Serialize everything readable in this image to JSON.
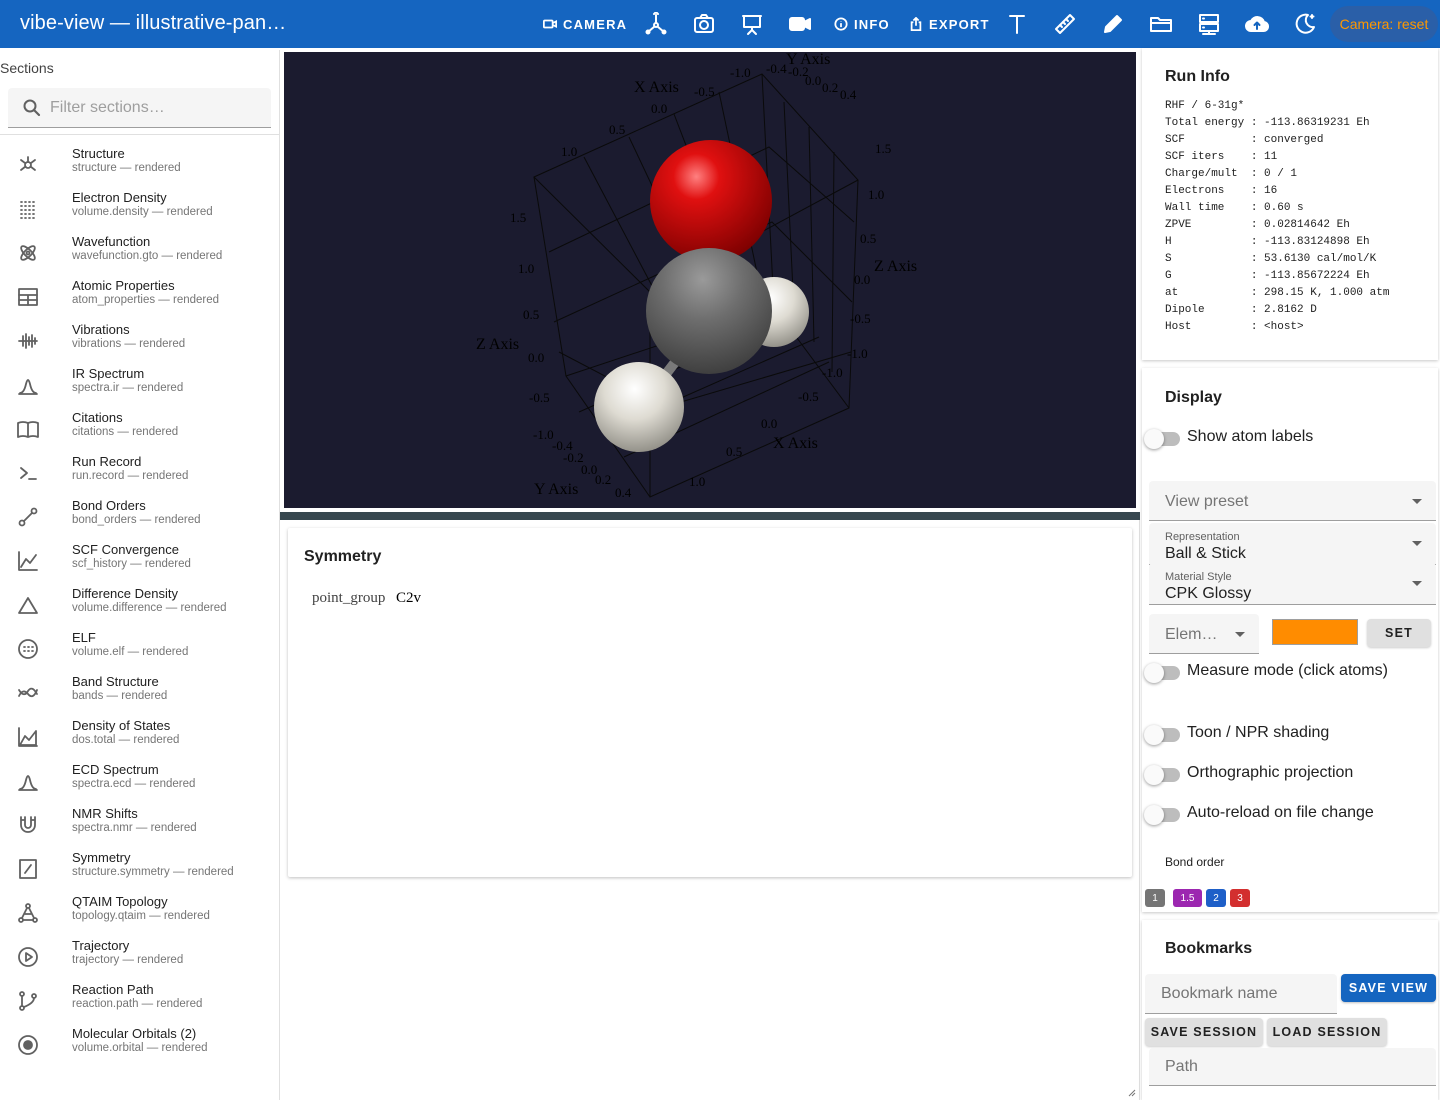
{
  "app": {
    "title": "vibe-view — illustrative-pan…"
  },
  "toolbar": {
    "camera_label": "CAMERA",
    "info_label": "INFO",
    "export_label": "EXPORT",
    "camera_reset_label": "Camera: reset",
    "icons": [
      "axes-icon",
      "screenshot-icon",
      "presentation-icon",
      "video-icon",
      "text-icon",
      "ruler-icon",
      "pencil-icon",
      "folder-icon",
      "server-icon",
      "cloud-upload-icon",
      "theme-icon"
    ]
  },
  "sidebar": {
    "heading": "Sections",
    "filter_placeholder": "Filter sections…",
    "items": [
      {
        "name": "Structure",
        "sub": "structure — rendered",
        "icon": "molecule-icon"
      },
      {
        "name": "Electron Density",
        "sub": "volume.density — rendered",
        "icon": "dot-grid-icon"
      },
      {
        "name": "Wavefunction",
        "sub": "wavefunction.gto — rendered",
        "icon": "atom-icon"
      },
      {
        "name": "Atomic Properties",
        "sub": "atom_properties — rendered",
        "icon": "table-icon"
      },
      {
        "name": "Vibrations",
        "sub": "vibrations — rendered",
        "icon": "waveform-icon"
      },
      {
        "name": "IR Spectrum",
        "sub": "spectra.ir — rendered",
        "icon": "peak-icon"
      },
      {
        "name": "Citations",
        "sub": "citations — rendered",
        "icon": "book-icon"
      },
      {
        "name": "Run Record",
        "sub": "run.record — rendered",
        "icon": "terminal-icon"
      },
      {
        "name": "Bond Orders",
        "sub": "bond_orders — rendered",
        "icon": "bond-icon"
      },
      {
        "name": "SCF Convergence",
        "sub": "scf_history — rendered",
        "icon": "line-chart-icon"
      },
      {
        "name": "Difference Density",
        "sub": "volume.difference — rendered",
        "icon": "triangle-icon"
      },
      {
        "name": "ELF",
        "sub": "volume.elf — rendered",
        "icon": "dotted-circle-icon"
      },
      {
        "name": "Band Structure",
        "sub": "bands — rendered",
        "icon": "bands-icon"
      },
      {
        "name": "Density of States",
        "sub": "dos.total — rendered",
        "icon": "area-chart-icon"
      },
      {
        "name": "ECD Spectrum",
        "sub": "spectra.ecd — rendered",
        "icon": "peak-icon"
      },
      {
        "name": "NMR Shifts",
        "sub": "spectra.nmr — rendered",
        "icon": "magnet-icon"
      },
      {
        "name": "Symmetry",
        "sub": "structure.symmetry — rendered",
        "icon": "mirror-icon"
      },
      {
        "name": "QTAIM Topology",
        "sub": "topology.qtaim — rendered",
        "icon": "graph-icon"
      },
      {
        "name": "Trajectory",
        "sub": "trajectory — rendered",
        "icon": "play-icon"
      },
      {
        "name": "Reaction Path",
        "sub": "reaction.path — rendered",
        "icon": "branch-icon"
      },
      {
        "name": "Molecular Orbitals (2)",
        "sub": "volume.orbital — rendered",
        "icon": "orbital-icon"
      }
    ]
  },
  "viewer": {
    "axis_labels": {
      "x": "X Axis",
      "y": "Y Axis",
      "z": "Z Axis"
    },
    "ticks": {
      "top_x": [
        "0.5",
        "0.0",
        "-0.5",
        "-1.0"
      ],
      "top_y": [
        "-0.4",
        "-0.2",
        "0.0",
        "0.2",
        "0.4"
      ],
      "right_z": [
        "1.5",
        "1.0",
        "0.5",
        "0.0",
        "-0.5",
        "-1.0"
      ],
      "left_z": [
        "1.5",
        "1.0",
        "0.5",
        "0.0",
        "-0.5",
        "-1.0"
      ],
      "left_zz": [
        "1.0",
        "1.5"
      ],
      "bottom_y": [
        "-0.4",
        "-0.2",
        "0.0",
        "0.2",
        "0.4"
      ],
      "bottom_x": [
        "-1.0",
        "-0.5",
        "0.0",
        "0.5",
        "1.0"
      ]
    }
  },
  "symmetry": {
    "title": "Symmetry",
    "key": "point_group",
    "value": "C2v"
  },
  "run_info": {
    "title": "Run Info",
    "lines": [
      "RHF / 6-31g*",
      "Total energy : -113.86319231 Eh",
      "SCF          : converged",
      "SCF iters    : 11",
      "Charge/mult  : 0 / 1",
      "Electrons    : 16",
      "Wall time    : 0.60 s",
      "ZPVE         : 0.02814642 Eh",
      "H            : -113.83124898 Eh",
      "S            : 53.6130 cal/mol/K",
      "G            : -113.85672224 Eh",
      "at           : 298.15 K, 1.000 atm",
      "Dipole       : 2.8162 D",
      "Host         : <host>"
    ]
  },
  "display": {
    "title": "Display",
    "show_atom_labels": "Show atom labels",
    "view_preset_placeholder": "View preset",
    "representation_label": "Representation",
    "representation_value": "Ball & Stick",
    "material_label": "Material Style",
    "material_value": "CPK Glossy",
    "element_placeholder": "Elem…",
    "element_color": "#ff8c00",
    "set_label": "SET",
    "measure_mode": "Measure mode (click atoms)",
    "toon_shading": "Toon / NPR shading",
    "orthographic": "Orthographic projection",
    "auto_reload": "Auto-reload on file change",
    "bond_order_label": "Bond order",
    "bond_orders": [
      {
        "label": "1",
        "color": "#757575"
      },
      {
        "label": "1.5",
        "color": "#9c27b0"
      },
      {
        "label": "2",
        "color": "#1e5fc8"
      },
      {
        "label": "3",
        "color": "#d32f2f"
      }
    ]
  },
  "bookmarks": {
    "title": "Bookmarks",
    "name_placeholder": "Bookmark name",
    "save_view": "SAVE VIEW",
    "save_session": "SAVE SESSION",
    "load_session": "LOAD SESSION",
    "path_placeholder": "Path"
  }
}
